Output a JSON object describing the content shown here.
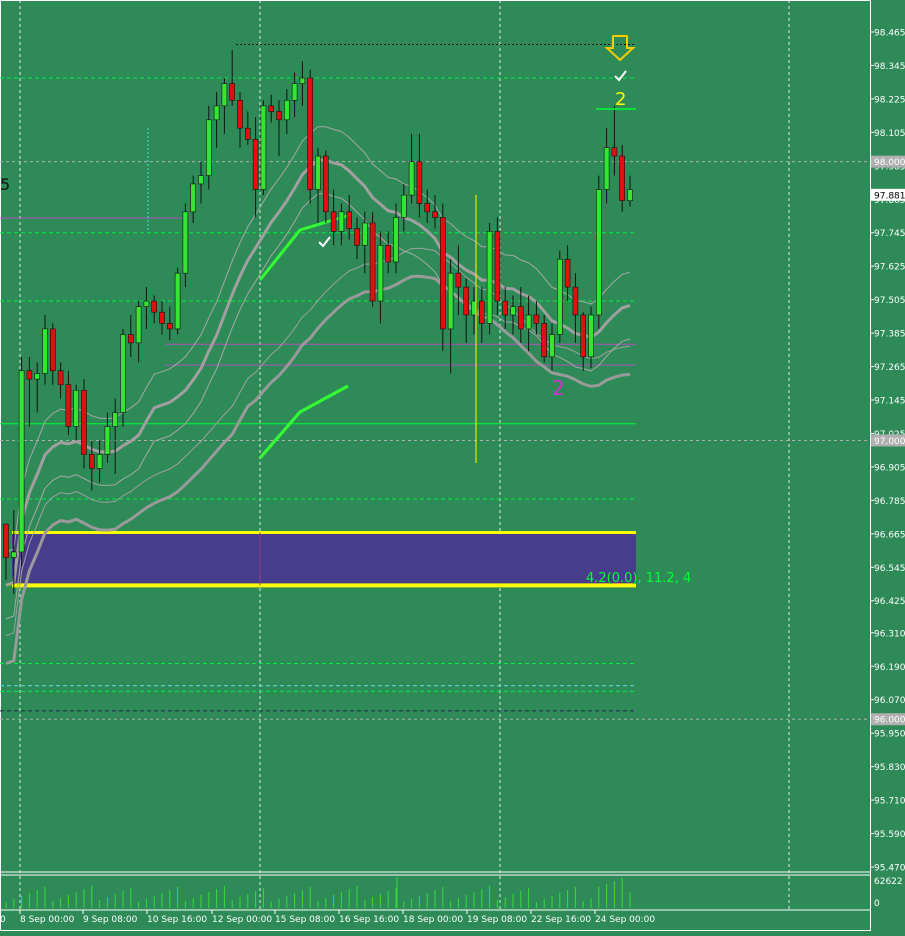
{
  "chart_data": {
    "type": "candlestick",
    "ylim": [
      95.41,
      98.53
    ],
    "y_ticks": [
      "98.465",
      "98.345",
      "98.225",
      "98.105",
      "97.985",
      "97.865",
      "97.745",
      "97.625",
      "97.505",
      "97.385",
      "97.265",
      "97.145",
      "97.025",
      "96.905",
      "96.785",
      "96.665",
      "96.545",
      "96.425",
      "96.310",
      "96.190",
      "96.070",
      "95.950",
      "95.830",
      "95.710",
      "95.590",
      "95.470"
    ],
    "x_ticks": [
      "8 Sep 00:00",
      "9 Sep 08:00",
      "10 Sep 16:00",
      "12 Sep 00:00",
      "15 Sep 08:00",
      "16 Sep 16:00",
      "18 Sep 00:00",
      "19 Sep 08:00",
      "22 Sep 16:00",
      "24 Sep 00:00"
    ],
    "x_tick_first": "0",
    "price_badges": [
      "98.000",
      "97.881",
      "97.000",
      "96.000"
    ],
    "candles": [
      [
        96.7,
        96.7,
        96.5,
        96.58
      ],
      [
        96.58,
        96.75,
        96.45,
        96.6
      ],
      [
        96.6,
        97.3,
        96.55,
        97.25
      ],
      [
        97.25,
        97.3,
        97.05,
        97.22
      ],
      [
        97.22,
        97.28,
        97.1,
        97.24
      ],
      [
        97.24,
        97.45,
        97.2,
        97.4
      ],
      [
        97.4,
        97.42,
        97.2,
        97.25
      ],
      [
        97.25,
        97.28,
        97.15,
        97.2
      ],
      [
        97.2,
        97.25,
        97.02,
        97.05
      ],
      [
        97.05,
        97.2,
        97.0,
        97.18
      ],
      [
        97.18,
        97.22,
        96.9,
        96.95
      ],
      [
        96.95,
        97.0,
        96.82,
        96.9
      ],
      [
        96.9,
        97.0,
        96.85,
        96.95
      ],
      [
        96.95,
        97.1,
        96.92,
        97.05
      ],
      [
        97.05,
        97.15,
        96.88,
        97.1
      ],
      [
        97.1,
        97.4,
        97.05,
        97.38
      ],
      [
        97.38,
        97.45,
        97.3,
        97.35
      ],
      [
        97.35,
        97.5,
        97.28,
        97.48
      ],
      [
        97.48,
        97.55,
        97.4,
        97.5
      ],
      [
        97.5,
        97.52,
        97.42,
        97.46
      ],
      [
        97.46,
        97.5,
        97.38,
        97.42
      ],
      [
        97.42,
        97.48,
        97.36,
        97.4
      ],
      [
        97.4,
        97.62,
        97.38,
        97.6
      ],
      [
        97.6,
        97.85,
        97.55,
        97.82
      ],
      [
        97.82,
        97.95,
        97.78,
        97.92
      ],
      [
        97.92,
        98.0,
        97.85,
        97.95
      ],
      [
        97.95,
        98.2,
        97.9,
        98.15
      ],
      [
        98.15,
        98.25,
        98.05,
        98.2
      ],
      [
        98.2,
        98.3,
        98.1,
        98.28
      ],
      [
        98.28,
        98.4,
        98.2,
        98.22
      ],
      [
        98.22,
        98.25,
        98.05,
        98.12
      ],
      [
        98.12,
        98.18,
        98.06,
        98.08
      ],
      [
        98.08,
        98.16,
        97.8,
        97.9
      ],
      [
        97.9,
        98.22,
        97.88,
        98.2
      ],
      [
        98.2,
        98.24,
        98.14,
        98.18
      ],
      [
        98.18,
        98.22,
        98.02,
        98.15
      ],
      [
        98.15,
        98.26,
        98.1,
        98.22
      ],
      [
        98.22,
        98.32,
        98.16,
        98.28
      ],
      [
        98.28,
        98.36,
        98.2,
        98.3
      ],
      [
        98.3,
        98.33,
        97.85,
        97.9
      ],
      [
        97.9,
        98.05,
        97.78,
        98.02
      ],
      [
        98.02,
        98.04,
        97.78,
        97.82
      ],
      [
        97.82,
        97.9,
        97.7,
        97.75
      ],
      [
        97.75,
        97.85,
        97.7,
        97.82
      ],
      [
        97.82,
        97.88,
        97.72,
        97.76
      ],
      [
        97.76,
        97.8,
        97.65,
        97.7
      ],
      [
        97.7,
        97.82,
        97.6,
        97.78
      ],
      [
        97.78,
        97.82,
        97.48,
        97.5
      ],
      [
        97.5,
        97.75,
        97.42,
        97.7
      ],
      [
        97.7,
        97.75,
        97.6,
        97.64
      ],
      [
        97.64,
        97.85,
        97.6,
        97.8
      ],
      [
        97.8,
        97.92,
        97.75,
        97.88
      ],
      [
        97.88,
        98.1,
        97.85,
        98.0
      ],
      [
        98.0,
        98.1,
        97.8,
        97.85
      ],
      [
        97.85,
        97.9,
        97.78,
        97.82
      ],
      [
        97.82,
        97.88,
        97.76,
        97.8
      ],
      [
        97.8,
        97.85,
        97.32,
        97.4
      ],
      [
        97.4,
        97.65,
        97.24,
        97.6
      ],
      [
        97.6,
        97.7,
        97.45,
        97.55
      ],
      [
        97.55,
        97.58,
        97.35,
        97.45
      ],
      [
        97.45,
        97.55,
        97.38,
        97.5
      ],
      [
        97.5,
        97.55,
        97.35,
        97.42
      ],
      [
        97.42,
        97.78,
        97.38,
        97.75
      ],
      [
        97.75,
        97.8,
        97.45,
        97.5
      ],
      [
        97.5,
        97.55,
        97.4,
        97.45
      ],
      [
        97.45,
        97.52,
        97.38,
        97.48
      ],
      [
        97.48,
        97.55,
        97.35,
        97.4
      ],
      [
        97.4,
        97.52,
        97.32,
        97.45
      ],
      [
        97.45,
        97.5,
        97.38,
        97.42
      ],
      [
        97.42,
        97.45,
        97.28,
        97.3
      ],
      [
        97.3,
        97.42,
        97.25,
        97.38
      ],
      [
        97.38,
        97.68,
        97.35,
        97.65
      ],
      [
        97.65,
        97.7,
        97.5,
        97.55
      ],
      [
        97.55,
        97.6,
        97.35,
        97.45
      ],
      [
        97.45,
        97.46,
        97.25,
        97.3
      ],
      [
        97.3,
        97.48,
        97.26,
        97.45
      ],
      [
        97.45,
        97.95,
        97.4,
        97.9
      ],
      [
        97.9,
        98.12,
        97.85,
        98.05
      ],
      [
        98.05,
        98.2,
        97.95,
        98.02
      ],
      [
        98.02,
        98.06,
        97.82,
        97.86
      ],
      [
        97.86,
        97.95,
        97.84,
        97.9
      ]
    ],
    "volume_top_label": "62622",
    "volume_bottom_label": "0",
    "annotation_text": "4.2(0.0), 11.2, 4",
    "wave_label_upper": "2",
    "wave_label_lower": "2",
    "left_edge_label": "5",
    "zone": [
      96.48,
      96.67
    ],
    "horizontal_levels": {
      "green_solid": 97.06,
      "green_dashed": [
        98.3,
        97.745,
        97.5,
        96.79,
        96.2,
        96.1
      ],
      "cyan_dashed": [
        96.12
      ],
      "dark_dashed": [
        96.03
      ],
      "black_dotted_top": 98.42,
      "purple": [
        97.345,
        97.27
      ],
      "gray_dashed": [
        98.0,
        97.0,
        96.0
      ]
    },
    "grid": true
  }
}
